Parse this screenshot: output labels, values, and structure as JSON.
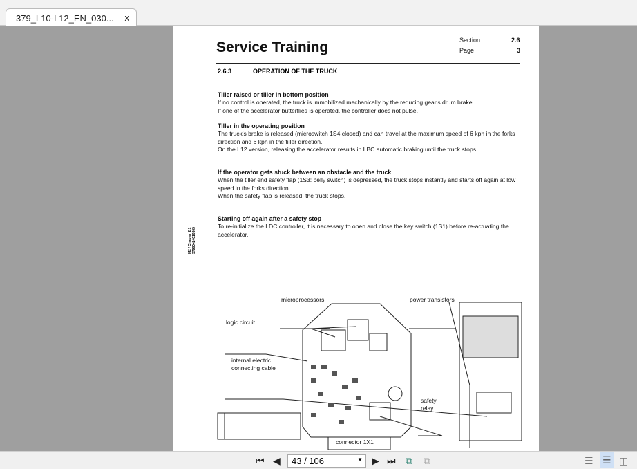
{
  "tab": {
    "title": "379_L10-L12_EN_030...",
    "close": "x"
  },
  "header": {
    "title": "Service Training",
    "section_label": "Section",
    "section_value": "2.6",
    "page_label": "Page",
    "page_value": "3"
  },
  "section": {
    "number": "2.6.3",
    "title": "OPERATION OF THE TRUCK"
  },
  "blocks": [
    {
      "heading": "Tiller raised or tiller in bottom position",
      "lines": [
        "If no control is operated, the truck is immobilized mechanically by the reducing gear's drum brake.",
        "If one of the accelerator butterflies is operated, the controller does not pulse."
      ]
    },
    {
      "heading": "Tiller in the operating position",
      "lines": [
        "The truck's brake is released (microswitch 1S4 closed) and can travel at the maximum speed of 6 kph in the forks direction and 6 kph in the tiller direction.",
        "On the L12 version, releasing the accelerator results in LBC automatic braking until the truck stops."
      ]
    },
    {
      "heading": "If the operator gets stuck between an obstacle and the truck",
      "lines": [
        "When the tiller end safety flap (1S3: belly switch) is depressed, the truck stops instantly and starts off again at low speed in the forks direction.",
        "When the safety flap is released, the truck stops."
      ]
    },
    {
      "heading": "Starting off again after a safety stop",
      "lines": [
        "To re-initialize the LDC controller, it is necessary to open and close the key switch (1S1) before re-actuating the accelerator."
      ]
    }
  ],
  "side_note": {
    "line1": "M2 / Chapter 2.1",
    "line2": "37980424010305"
  },
  "diagram": {
    "microprocessors": "microprocessors",
    "power_transistors": "power transistors",
    "logic_circuit": "logic circuit",
    "cable1": "internal electric",
    "cable2": "connecting cable",
    "relay1": "safety",
    "relay2": "relay",
    "connector": "connector 1X1"
  },
  "toolbar": {
    "page_display": "43 / 106"
  }
}
